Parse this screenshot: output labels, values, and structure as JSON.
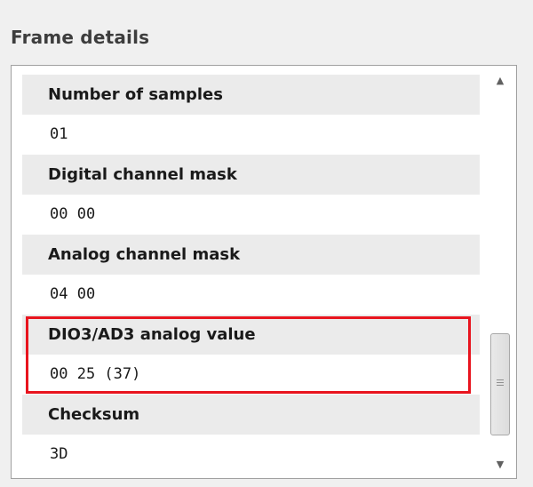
{
  "panel": {
    "title": "Frame details"
  },
  "fields": [
    {
      "name": "Number of samples",
      "value": "01"
    },
    {
      "name": "Digital channel mask",
      "value": "00 00"
    },
    {
      "name": "Analog channel mask",
      "value": "04 00"
    },
    {
      "name": "DIO3/AD3 analog value",
      "value": "00 25 (37)",
      "highlighted": true
    },
    {
      "name": "Checksum",
      "value": "3D"
    }
  ],
  "scrollbar": {
    "up_icon": "scroll-up-arrow-icon",
    "down_icon": "scroll-down-arrow-icon"
  },
  "colors": {
    "highlight": "#e8141e",
    "row_header_bg": "#ebebeb"
  }
}
